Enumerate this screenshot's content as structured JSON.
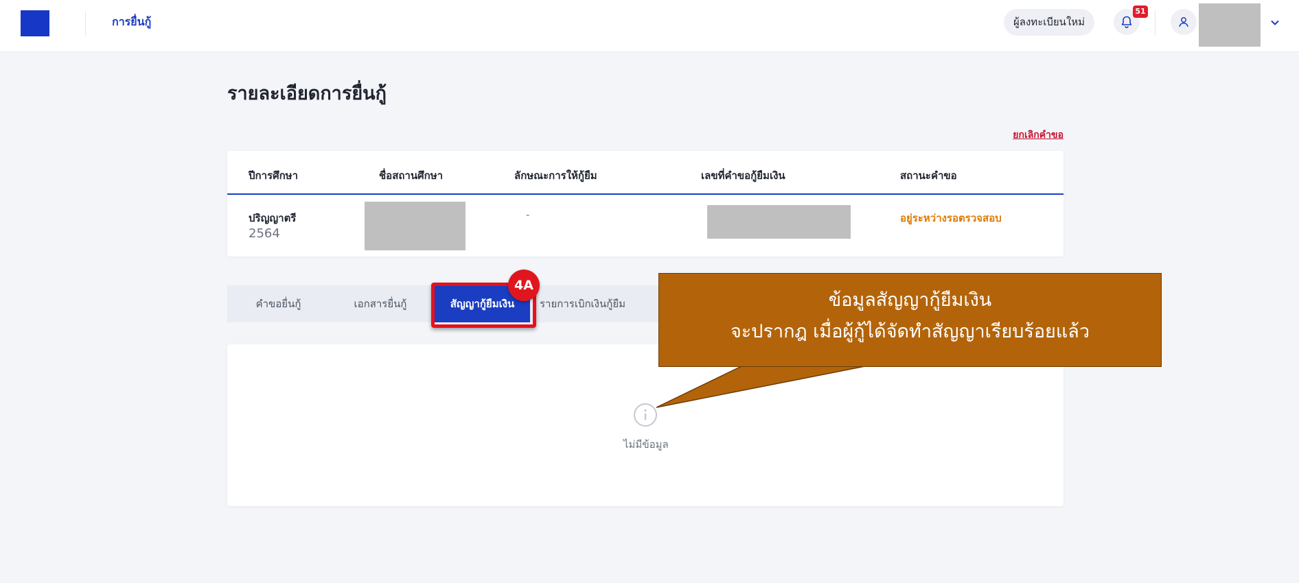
{
  "header": {
    "nav_label": "การยื่นกู้",
    "register_label": "ผู้ลงทะเบียนใหม่",
    "notification_count": "51",
    "icons": [
      "bell-icon",
      "user-icon",
      "chevron-down-icon"
    ]
  },
  "page": {
    "title": "รายละเอียดการยื่นกู้",
    "cancel_link": "ยกเลิกคำขอ"
  },
  "summary": {
    "columns": [
      "ปีการศึกษา",
      "ชื่อสถานศึกษา",
      "ลักษณะการให้กู้ยืม",
      "เลขที่คำขอกู้ยืมเงิน",
      "สถานะคำขอ"
    ],
    "row": {
      "level": "ปริญญาตรี",
      "year": "2564",
      "loan_type": "-",
      "status": "อยู่ระหว่างรอตรวจสอบ"
    }
  },
  "tabs": {
    "items": [
      "คำขอยื่นกู้",
      "เอกสารยื่นกู้",
      "สัญญากู้ยืมเงิน",
      "รายการเบิกเงินกู้ยืม"
    ],
    "active": "สัญญากู้ยืมเงิน",
    "marker": "4A"
  },
  "content": {
    "empty_text": "ไม่มีข้อมูล",
    "icon": "info-icon"
  },
  "callout": {
    "line1": "ข้อมูลสัญญากู้ยืมเงิน",
    "line2": "จะปรากฎ เมื่อผู้กู้ได้จัดทำสัญญาเรียบร้อยแล้ว",
    "color": "#b3640a"
  },
  "colors": {
    "brand": "#1a3dc2",
    "status": "#e07b00",
    "danger": "#c8102e"
  }
}
